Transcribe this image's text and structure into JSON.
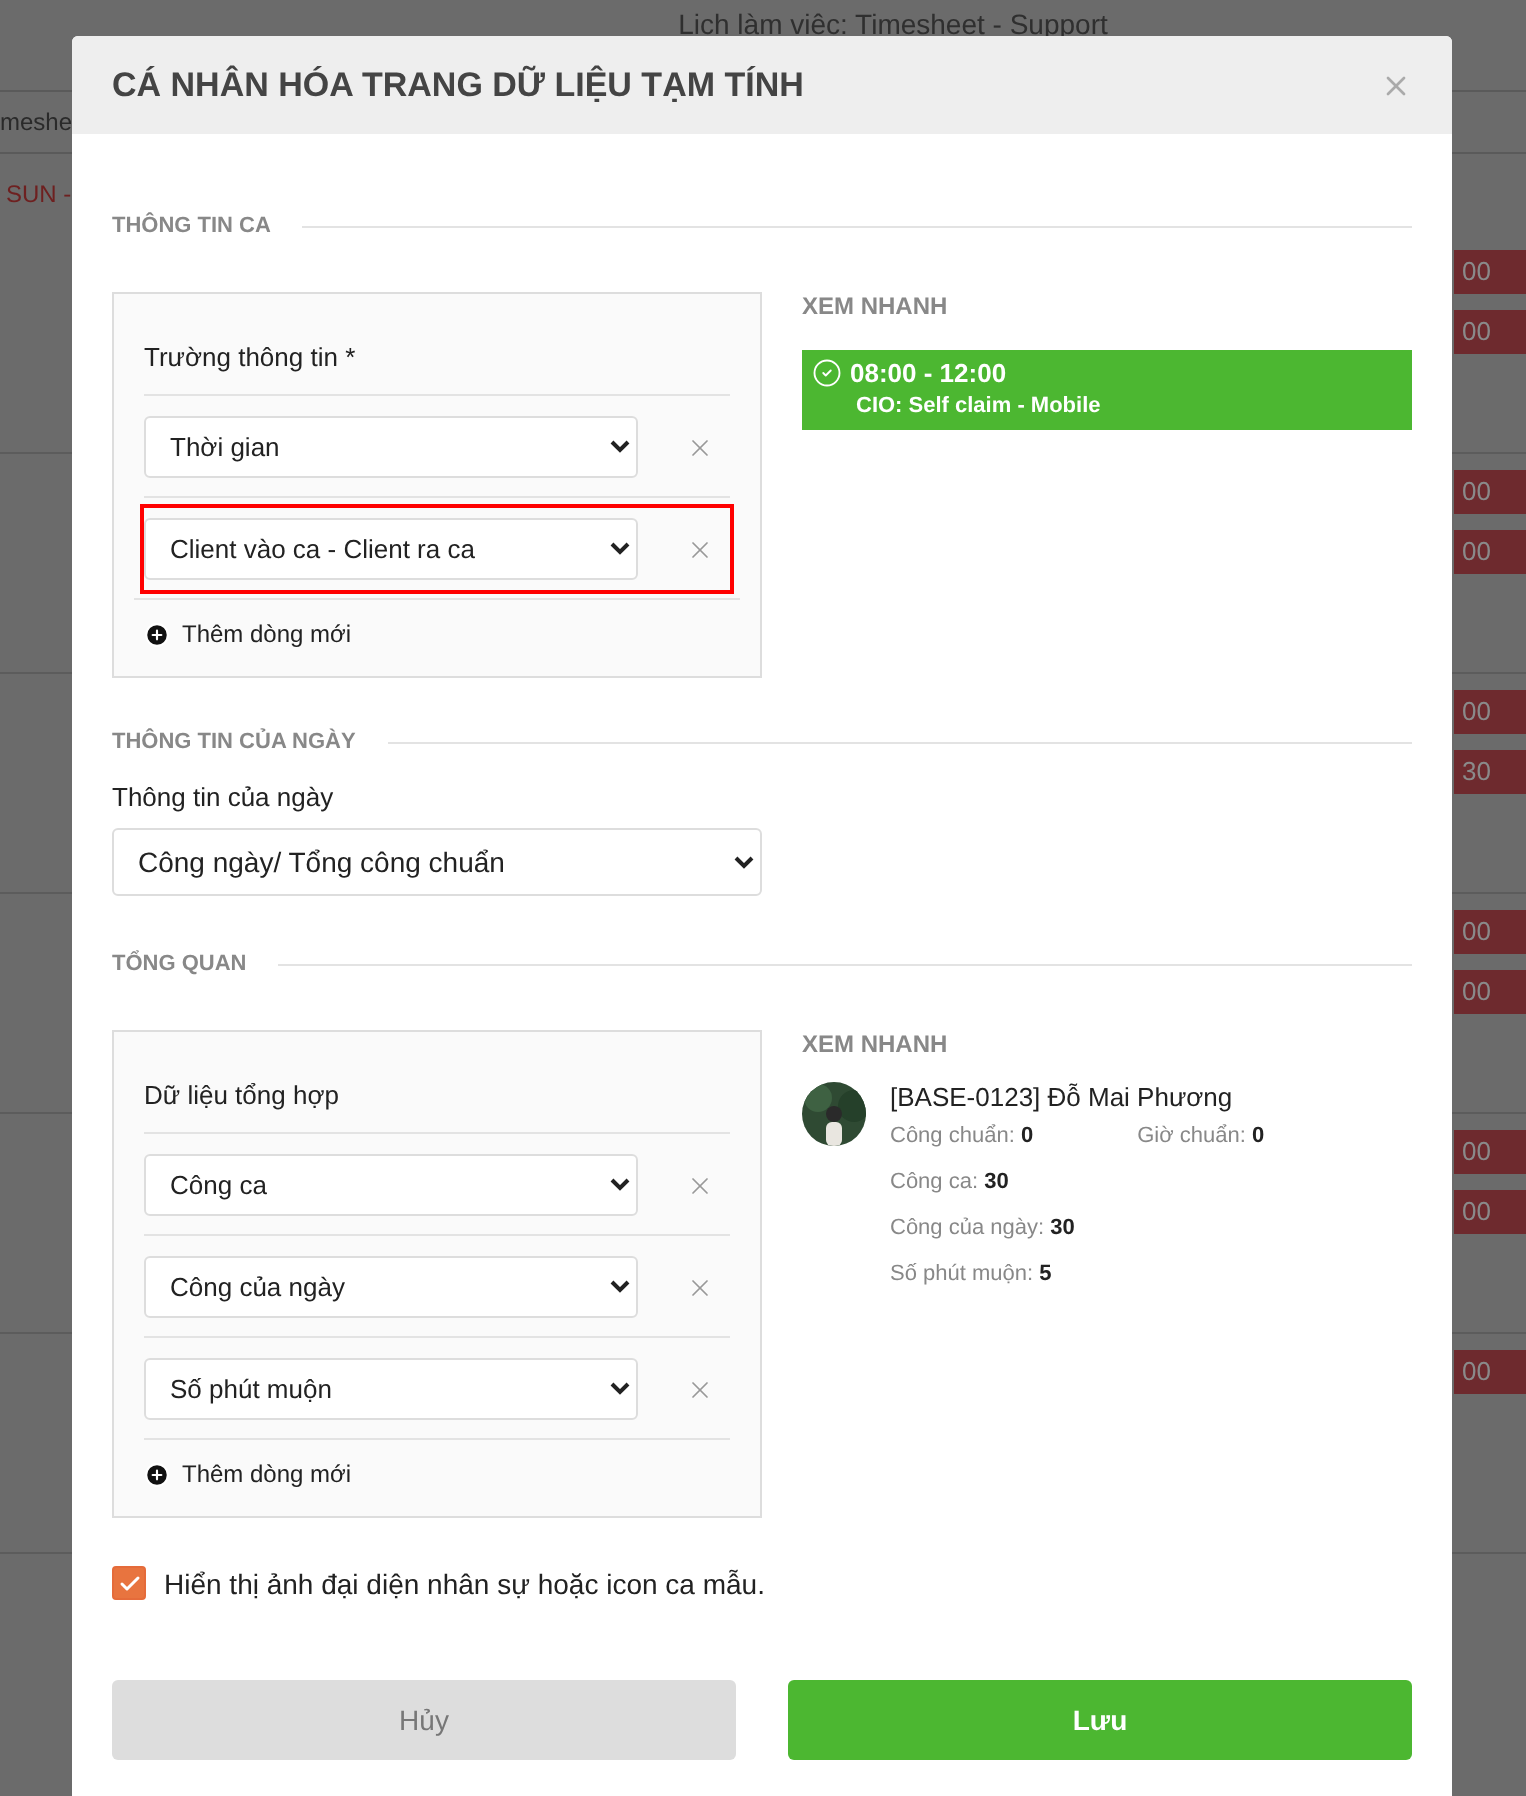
{
  "background": {
    "title": "Lịch làm việc: Timesheet - Support",
    "tab_text": "meshe",
    "day_label": "SUN -",
    "rows": [
      {
        "chips": [
          "00",
          "00"
        ]
      },
      {
        "chips": [
          "00",
          "00"
        ]
      },
      {
        "chips": [
          "00",
          "30"
        ]
      },
      {
        "chips": [
          "00",
          "00"
        ]
      },
      {
        "chips": [
          "00",
          "00"
        ]
      },
      {
        "chips": [
          "00"
        ]
      }
    ]
  },
  "dialog": {
    "title": "CÁ NHÂN HÓA TRANG DỮ LIỆU TẠM TÍNH",
    "shift_info": {
      "heading": "THÔNG TIN CA",
      "field_label": "Trường thông tin *",
      "rows": [
        {
          "value": "Thời gian",
          "highlighted": false
        },
        {
          "value": "Client vào ca - Client ra ca",
          "highlighted": true
        }
      ],
      "add_label": "Thêm dòng mới",
      "preview_heading": "XEM NHANH",
      "preview": {
        "time": "08:00 - 12:00",
        "detail": "CIO: Self claim - Mobile"
      }
    },
    "day_info": {
      "heading": "THÔNG TIN CỦA NGÀY",
      "label": "Thông tin của ngày",
      "value": "Công ngày/ Tổng công chuẩn"
    },
    "overview": {
      "heading": "TỔNG QUAN",
      "field_label": "Dữ liệu tổng hợp",
      "rows": [
        {
          "value": "Công ca",
          "highlighted": false
        },
        {
          "value": "Công của ngày",
          "highlighted": false
        },
        {
          "value": "Số phút muộn",
          "highlighted": false
        }
      ],
      "add_label": "Thêm dòng mới",
      "preview_heading": "XEM NHANH",
      "employee": {
        "name": "[BASE-0123] Đỗ Mai Phương",
        "side_stat": {
          "label": "Giờ chuẩn:",
          "value": "0"
        },
        "stats": [
          {
            "label": "Công chuẩn:",
            "value": "0"
          },
          {
            "label": "Công ca:",
            "value": "30"
          },
          {
            "label": "Công của ngày:",
            "value": "30"
          },
          {
            "label": "Số phút muộn:",
            "value": "5"
          }
        ]
      }
    },
    "checkbox": {
      "label": "Hiển thị ảnh đại diện nhân sự hoặc icon ca mẫu.",
      "checked": true
    },
    "buttons": [
      {
        "label": "Hủy",
        "kind": "secondary"
      },
      {
        "label": "Lưu",
        "kind": "primary"
      }
    ]
  }
}
